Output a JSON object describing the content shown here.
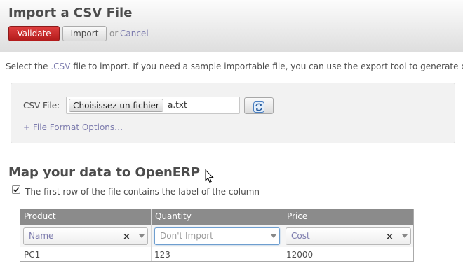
{
  "header": {
    "title": "Import a CSV File",
    "validate_label": "Validate",
    "import_label": "Import",
    "or_text": "or",
    "cancel_label": "Cancel"
  },
  "intro": {
    "text_before": "Select the ",
    "csv_link": ".CSV",
    "text_after": " file to import. If you need a sample importable file, you can use the export tool to generate one."
  },
  "file_panel": {
    "label": "CSV File:",
    "choose_button": "Choisissez un fichier",
    "file_name": "a.txt",
    "format_options": "+ File Format Options…"
  },
  "mapping": {
    "title": "Map your data to OpenERP",
    "first_row_label": "The first row of the file contains the label of the column",
    "first_row_checked": true,
    "columns": [
      {
        "header": "Product",
        "field": "Name",
        "cell": "PC1"
      },
      {
        "header": "Quantity",
        "field": "Don't Import",
        "cell": "123"
      },
      {
        "header": "Price",
        "field": "Cost",
        "cell": "12000"
      }
    ]
  }
}
